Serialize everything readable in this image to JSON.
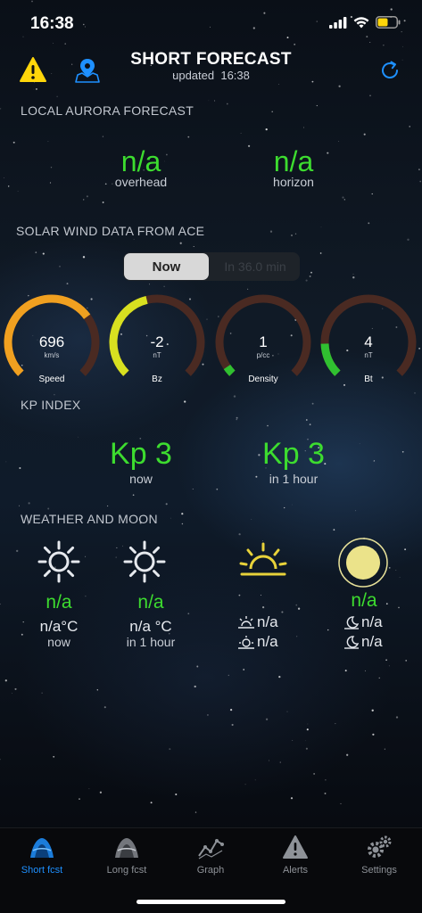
{
  "status_bar": {
    "time": "16:38"
  },
  "header": {
    "title": "SHORT FORECAST",
    "updated_label": "updated",
    "updated_time": "16:38"
  },
  "aurora": {
    "section_title": "LOCAL AURORA FORECAST",
    "overhead": {
      "value": "n/a",
      "label": "overhead"
    },
    "horizon": {
      "value": "n/a",
      "label": "horizon"
    }
  },
  "solar_wind": {
    "section_title": "SOLAR WIND DATA FROM ACE",
    "segments": [
      "Now",
      "In 36.0 min"
    ],
    "selected_segment": "Now",
    "gauges": [
      {
        "value": "696",
        "unit": "km/s",
        "name": "Speed",
        "level": 0.7,
        "color": "#f0a020"
      },
      {
        "value": "-2",
        "unit": "nT",
        "name": "Bz",
        "level": 0.45,
        "color": "#d8e020"
      },
      {
        "value": "1",
        "unit": "p/cc",
        "name": "Density",
        "level": 0.04,
        "color": "#30c030"
      },
      {
        "value": "4",
        "unit": "nT",
        "name": "Bt",
        "level": 0.16,
        "color": "#30c030"
      }
    ]
  },
  "kp": {
    "section_title": "KP INDEX",
    "now": {
      "value": "Kp 3",
      "label": "now"
    },
    "later": {
      "value": "Kp 3",
      "label": "in 1 hour"
    }
  },
  "weather": {
    "section_title": "WEATHER AND MOON",
    "now": {
      "value": "n/a",
      "temp": "n/a°C",
      "label": "now"
    },
    "hour": {
      "value": "n/a",
      "temp": "n/a °C",
      "label": "in 1 hour"
    },
    "sun": {
      "rise": "n/a",
      "set": "n/a"
    },
    "moon": {
      "value": "n/a",
      "rise": "n/a",
      "set": "n/a"
    }
  },
  "tabs": [
    {
      "label": "Short fcst",
      "icon": "short-forecast-icon",
      "active": true
    },
    {
      "label": "Long fcst",
      "icon": "long-forecast-icon",
      "active": false
    },
    {
      "label": "Graph",
      "icon": "graph-icon",
      "active": false
    },
    {
      "label": "Alerts",
      "icon": "alert-icon",
      "active": false
    },
    {
      "label": "Settings",
      "icon": "gear-icon",
      "active": false
    }
  ],
  "colors": {
    "accent_green": "#3ddc2f",
    "accent_blue": "#1e90ff",
    "warning_yellow": "#ffd60a"
  }
}
